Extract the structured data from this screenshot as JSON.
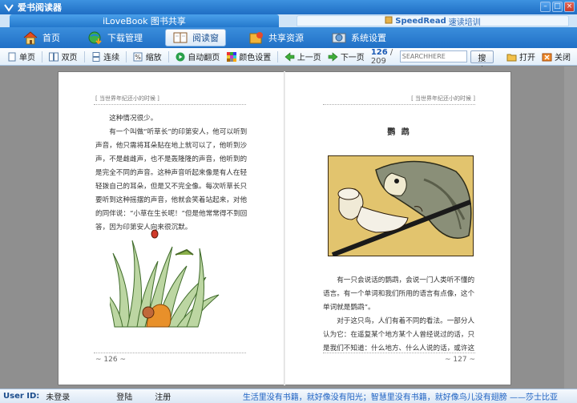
{
  "window": {
    "title": "爱书阅读器"
  },
  "tabs": [
    {
      "label": "iLoveBook 图书共享"
    },
    {
      "prefix": "SpeedRead",
      "label": "速读培训"
    }
  ],
  "nav": [
    {
      "label": "首页"
    },
    {
      "label": "下载管理"
    },
    {
      "label": "阅读窗"
    },
    {
      "label": "共享资源"
    },
    {
      "label": "系统设置"
    }
  ],
  "toolbar": {
    "single": "单页",
    "double": "双页",
    "continuous": "连续",
    "zoom": "缩放",
    "autoflip": "自动翻页",
    "color": "颜色设置",
    "prev": "上一页",
    "next": "下一页",
    "page_current": "126",
    "page_total": "/ 209",
    "search_placeholder": "SEARCHHERE",
    "search": "搜索",
    "open": "打开",
    "close": "关闭"
  },
  "book": {
    "running_head": "[ 当世界年纪还小的时候 ]",
    "left": {
      "paragraphs": [
        "这种情况很少。",
        "有一个叫做“听草长”的印第安人，他可以听到声音，他只需将耳朵贴在地上就可以了，他听到沙声，不是雌雌声，也不是轰隆隆的声音，他听到的是完全不同的声音。这种声音听起来像是有人在轻轻拨自己的耳朵，但是又不完全像。每次听草长只要听到这种摇摆的声音，他就会笑着站起来，对他的同伴说：“小草在生长呢！”但是他常常得不到回答，因为印第安人向来很沉默。"
      ],
      "folio": "~ 126 ~"
    },
    "right": {
      "chapter_title": "鹦 鹉",
      "paragraphs": [
        "有一只会说话的鹦鹉，会说一门人类听不懂的语言。有一个单词和我们所用的语言有点像，这个单词就是鹦鹉”。",
        "对于这只鸟，人们有着不同的看法。一部分人认为它：在遥复某个地方某个人曾经说过的话，只是我们不知道：什么地方、什么人说的话，或许这"
      ],
      "folio": "~ 127 ~"
    }
  },
  "status": {
    "user_label": "User ID:",
    "user_value": "未登录",
    "login": "登陆",
    "register": "注册",
    "quote": "生活里没有书籍，就好像没有阳光；智慧里没有书籍，就好像鸟儿没有翅膀 ——莎士比亚"
  },
  "colors": {
    "accent": "#2070c6",
    "link": "#1e62c3"
  }
}
